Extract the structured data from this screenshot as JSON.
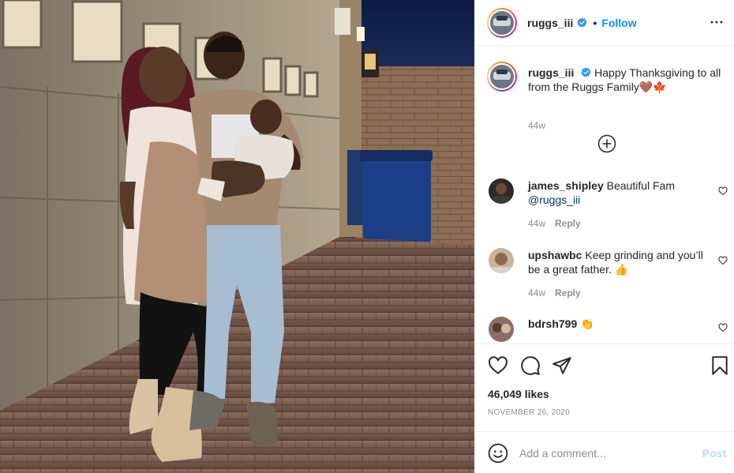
{
  "post": {
    "username": "ruggs_iii",
    "verified": true,
    "follow_label": "Follow",
    "more_icon": "more-options-icon",
    "caption": {
      "username": "ruggs_iii",
      "text": "Happy Thanksgiving to all from the Ruggs Family🤎🍁",
      "time": "44w"
    },
    "load_more_icon": "plus-circle-icon",
    "comments": [
      {
        "username": "james_shipley",
        "text": "Beautiful Fam",
        "mention": "@ruggs_iii",
        "time": "44w",
        "reply_label": "Reply"
      },
      {
        "username": "upshawbc",
        "text": "Keep grinding and you’ll be a great father. 👍",
        "mention": "",
        "time": "44w",
        "reply_label": "Reply"
      },
      {
        "username": "bdrsh799",
        "text": "👏",
        "mention": "",
        "time": "",
        "reply_label": ""
      }
    ],
    "actions": {
      "like_icon": "heart-icon",
      "comment_icon": "comment-icon",
      "share_icon": "share-icon",
      "save_icon": "bookmark-icon"
    },
    "likes": "46,049 likes",
    "date": "NOVEMBER 26, 2020",
    "add_comment": {
      "placeholder": "Add a comment...",
      "post_label": "Post",
      "emoji_icon": "emoji-icon"
    }
  },
  "colors": {
    "link_blue": "#0095f6",
    "post_disabled": "#b2dffc",
    "muted_text": "#8e8e8e",
    "border": "#efefef"
  }
}
